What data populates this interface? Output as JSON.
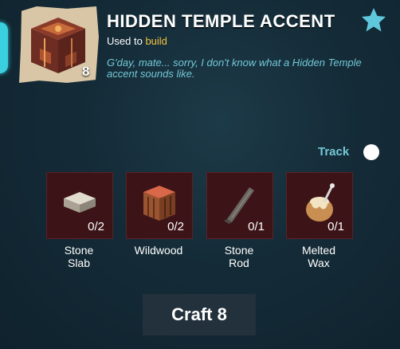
{
  "item": {
    "name": "HIDDEN TEMPLE ACCENT",
    "count": "8",
    "used_to_prefix": "Used to",
    "used_to_link": "build",
    "description": "G'day, mate... sorry, I don't know what a Hidden Temple accent sounds like."
  },
  "track": {
    "label": "Track",
    "enabled": false
  },
  "ingredients": [
    {
      "name_line1": "Stone",
      "name_line2": "Slab",
      "qty": "0/2",
      "icon": "stone-slab-icon"
    },
    {
      "name_line1": "Wildwood",
      "name_line2": "",
      "qty": "0/2",
      "icon": "wildwood-icon"
    },
    {
      "name_line1": "Stone",
      "name_line2": "Rod",
      "qty": "0/1",
      "icon": "stone-rod-icon"
    },
    {
      "name_line1": "Melted",
      "name_line2": "Wax",
      "qty": "0/1",
      "icon": "melted-wax-icon"
    }
  ],
  "craft_button": {
    "label": "Craft 8"
  },
  "colors": {
    "accent": "#74c8d6",
    "link": "#f4c33f",
    "slot_bg": "#3c1418",
    "star": "#5fc8dc"
  }
}
